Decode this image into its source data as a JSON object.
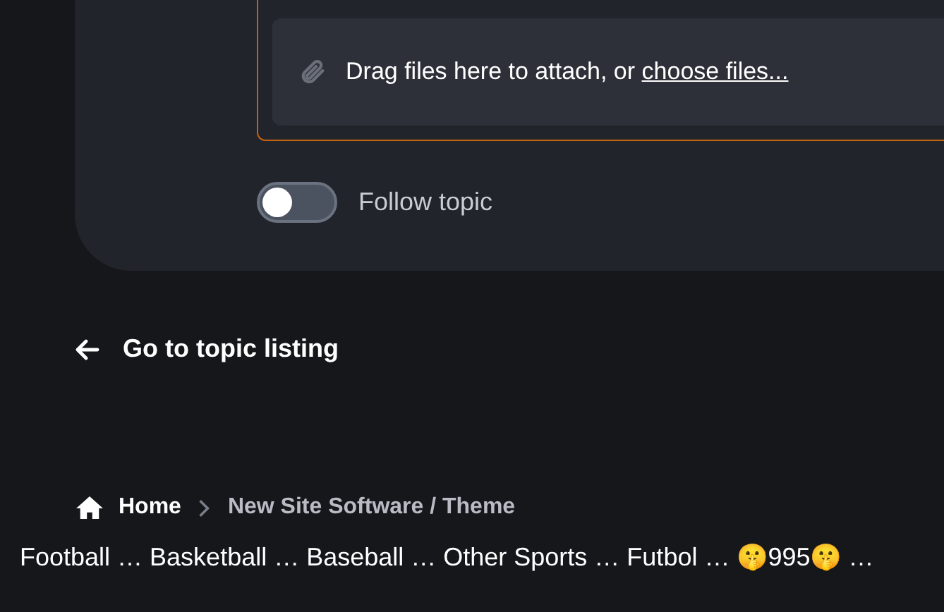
{
  "attach": {
    "prompt": "Drag files here to attach, or ",
    "link": "choose files..."
  },
  "follow_toggle": {
    "label": "Follow topic",
    "on": false
  },
  "back_link": {
    "label": "Go to topic listing"
  },
  "breadcrumb": [
    {
      "label": "Home",
      "kind": "home"
    },
    {
      "label": "New Site Software / Theme",
      "kind": "page"
    }
  ],
  "footer_text": "Football … Basketball … Baseball … Other Sports … Futbol … 🤫995🤫 …"
}
